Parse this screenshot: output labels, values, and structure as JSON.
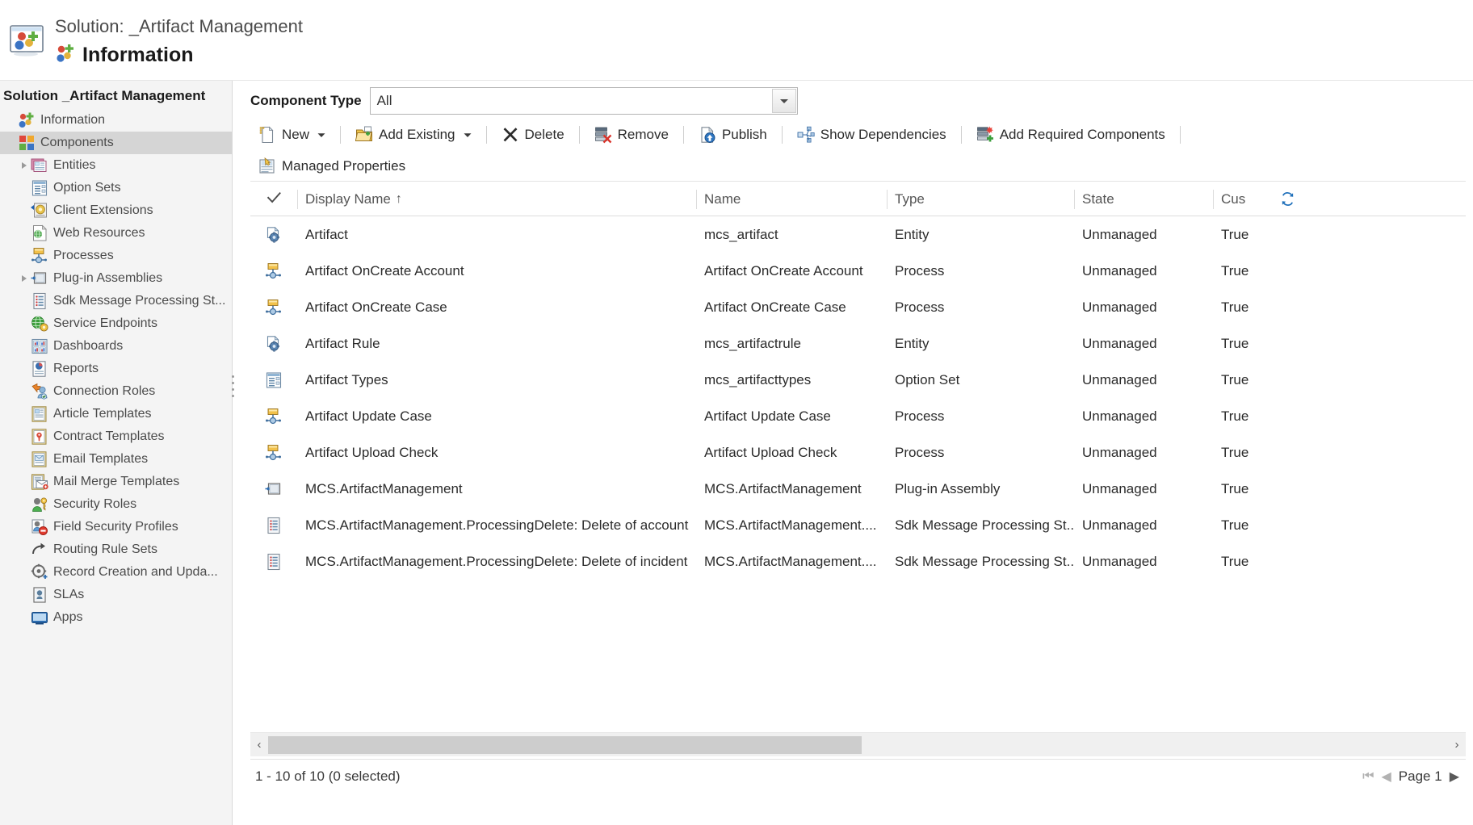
{
  "header": {
    "breadcrumb": "Solution: _Artifact Management",
    "title": "Information",
    "window_icon": "solution-window-icon",
    "title_icon": "solution-balls-icon"
  },
  "sidebar": {
    "title": "Solution _Artifact Management",
    "items": [
      {
        "label": "Information",
        "icon": "solution-balls-icon",
        "depth": 0,
        "twisty": false,
        "selected": false
      },
      {
        "label": "Components",
        "icon": "components-squares-icon",
        "depth": 0,
        "twisty": false,
        "selected": true
      },
      {
        "label": "Entities",
        "icon": "entities-icon",
        "depth": 2,
        "twisty": true,
        "selected": false
      },
      {
        "label": "Option Sets",
        "icon": "option-sets-icon",
        "depth": 2,
        "twisty": false,
        "selected": false
      },
      {
        "label": "Client Extensions",
        "icon": "client-extensions-icon",
        "depth": 2,
        "twisty": false,
        "selected": false
      },
      {
        "label": "Web Resources",
        "icon": "web-resources-icon",
        "depth": 2,
        "twisty": false,
        "selected": false
      },
      {
        "label": "Processes",
        "icon": "process-icon",
        "depth": 2,
        "twisty": false,
        "selected": false
      },
      {
        "label": "Plug-in Assemblies",
        "icon": "plugin-assembly-icon",
        "depth": 2,
        "twisty": true,
        "selected": false
      },
      {
        "label": "Sdk Message Processing St...",
        "icon": "sdk-message-icon",
        "depth": 2,
        "twisty": false,
        "selected": false
      },
      {
        "label": "Service Endpoints",
        "icon": "service-endpoint-icon",
        "depth": 2,
        "twisty": false,
        "selected": false
      },
      {
        "label": "Dashboards",
        "icon": "dashboards-icon",
        "depth": 2,
        "twisty": false,
        "selected": false
      },
      {
        "label": "Reports",
        "icon": "reports-icon",
        "depth": 2,
        "twisty": false,
        "selected": false
      },
      {
        "label": "Connection Roles",
        "icon": "connection-roles-icon",
        "depth": 2,
        "twisty": false,
        "selected": false
      },
      {
        "label": "Article Templates",
        "icon": "article-template-icon",
        "depth": 2,
        "twisty": false,
        "selected": false
      },
      {
        "label": "Contract Templates",
        "icon": "contract-template-icon",
        "depth": 2,
        "twisty": false,
        "selected": false
      },
      {
        "label": "Email Templates",
        "icon": "email-template-icon",
        "depth": 2,
        "twisty": false,
        "selected": false
      },
      {
        "label": "Mail Merge Templates",
        "icon": "mail-merge-icon",
        "depth": 2,
        "twisty": false,
        "selected": false
      },
      {
        "label": "Security Roles",
        "icon": "security-roles-icon",
        "depth": 2,
        "twisty": false,
        "selected": false
      },
      {
        "label": "Field Security Profiles",
        "icon": "field-security-icon",
        "depth": 2,
        "twisty": false,
        "selected": false
      },
      {
        "label": "Routing Rule Sets",
        "icon": "routing-rule-icon",
        "depth": 2,
        "twisty": false,
        "selected": false
      },
      {
        "label": "Record Creation and Upda...",
        "icon": "record-creation-icon",
        "depth": 2,
        "twisty": false,
        "selected": false
      },
      {
        "label": "SLAs",
        "icon": "sla-icon",
        "depth": 2,
        "twisty": false,
        "selected": false
      },
      {
        "label": "Apps",
        "icon": "apps-icon",
        "depth": 2,
        "twisty": false,
        "selected": false
      }
    ]
  },
  "component_type": {
    "label": "Component Type",
    "value": "All"
  },
  "toolbar": {
    "row1": [
      {
        "label": "New",
        "icon": "new-doc-icon",
        "dropdown": true,
        "sep_after": true
      },
      {
        "label": "Add Existing",
        "icon": "add-existing-icon",
        "dropdown": true,
        "sep_after": true
      },
      {
        "label": "Delete",
        "icon": "delete-x-icon",
        "dropdown": false,
        "sep_after": true
      },
      {
        "label": "Remove",
        "icon": "remove-icon",
        "dropdown": false,
        "sep_after": true
      },
      {
        "label": "Publish",
        "icon": "publish-icon",
        "dropdown": false,
        "sep_after": true
      },
      {
        "label": "Show Dependencies",
        "icon": "dependencies-icon",
        "dropdown": false,
        "sep_after": true
      },
      {
        "label": "Add Required Components",
        "icon": "add-required-icon",
        "dropdown": false,
        "sep_after": true
      }
    ],
    "row2": [
      {
        "label": "Managed Properties",
        "icon": "managed-properties-icon",
        "dropdown": false,
        "sep_after": false
      }
    ]
  },
  "grid": {
    "columns": [
      {
        "key": "check",
        "label": "",
        "sort": ""
      },
      {
        "key": "display",
        "label": "Display Name",
        "sort": "↑"
      },
      {
        "key": "name",
        "label": "Name",
        "sort": ""
      },
      {
        "key": "type",
        "label": "Type",
        "sort": ""
      },
      {
        "key": "state",
        "label": "State",
        "sort": ""
      },
      {
        "key": "cus",
        "label": "Cus",
        "sort": ""
      }
    ],
    "refresh_icon": "refresh-icon",
    "rows": [
      {
        "icon": "entity-icon",
        "display": "Artifact",
        "name": "mcs_artifact",
        "type": "Entity",
        "state": "Unmanaged",
        "cus": "True"
      },
      {
        "icon": "process-icon",
        "display": "Artifact OnCreate Account",
        "name": "Artifact OnCreate Account",
        "type": "Process",
        "state": "Unmanaged",
        "cus": "True"
      },
      {
        "icon": "process-icon",
        "display": "Artifact OnCreate Case",
        "name": "Artifact OnCreate Case",
        "type": "Process",
        "state": "Unmanaged",
        "cus": "True"
      },
      {
        "icon": "entity-icon",
        "display": "Artifact Rule",
        "name": "mcs_artifactrule",
        "type": "Entity",
        "state": "Unmanaged",
        "cus": "True"
      },
      {
        "icon": "optionset-icon",
        "display": "Artifact Types",
        "name": "mcs_artifacttypes",
        "type": "Option Set",
        "state": "Unmanaged",
        "cus": "True"
      },
      {
        "icon": "process-icon",
        "display": "Artifact Update Case",
        "name": "Artifact Update Case",
        "type": "Process",
        "state": "Unmanaged",
        "cus": "True"
      },
      {
        "icon": "process-icon",
        "display": "Artifact Upload Check",
        "name": "Artifact Upload Check",
        "type": "Process",
        "state": "Unmanaged",
        "cus": "True"
      },
      {
        "icon": "plugin-assembly-icon",
        "display": "MCS.ArtifactManagement",
        "name": "MCS.ArtifactManagement",
        "type": "Plug-in Assembly",
        "state": "Unmanaged",
        "cus": "True"
      },
      {
        "icon": "sdk-message-icon",
        "display": "MCS.ArtifactManagement.ProcessingDelete: Delete of account",
        "name": "MCS.ArtifactManagement....",
        "type": "Sdk Message Processing St...",
        "state": "Unmanaged",
        "cus": "True"
      },
      {
        "icon": "sdk-message-icon",
        "display": "MCS.ArtifactManagement.ProcessingDelete: Delete of incident",
        "name": "MCS.ArtifactManagement....",
        "type": "Sdk Message Processing St...",
        "state": "Unmanaged",
        "cus": "True"
      }
    ]
  },
  "footer": {
    "status": "1 - 10 of 10 (0 selected)",
    "page_label": "Page 1",
    "first_icon": "page-first-icon",
    "prev_icon": "page-prev-icon",
    "next_icon": "page-next-icon"
  },
  "scrollbar": {
    "left_icon": "scroll-left-icon",
    "right_icon": "scroll-right-icon"
  },
  "colors": {
    "selection": "#d5d5d5",
    "sidebar_bg": "#f4f4f4",
    "accent_blue": "#1e6fba",
    "red": "#cc2222",
    "green": "#3f9a33",
    "gold": "#e8b63c"
  }
}
